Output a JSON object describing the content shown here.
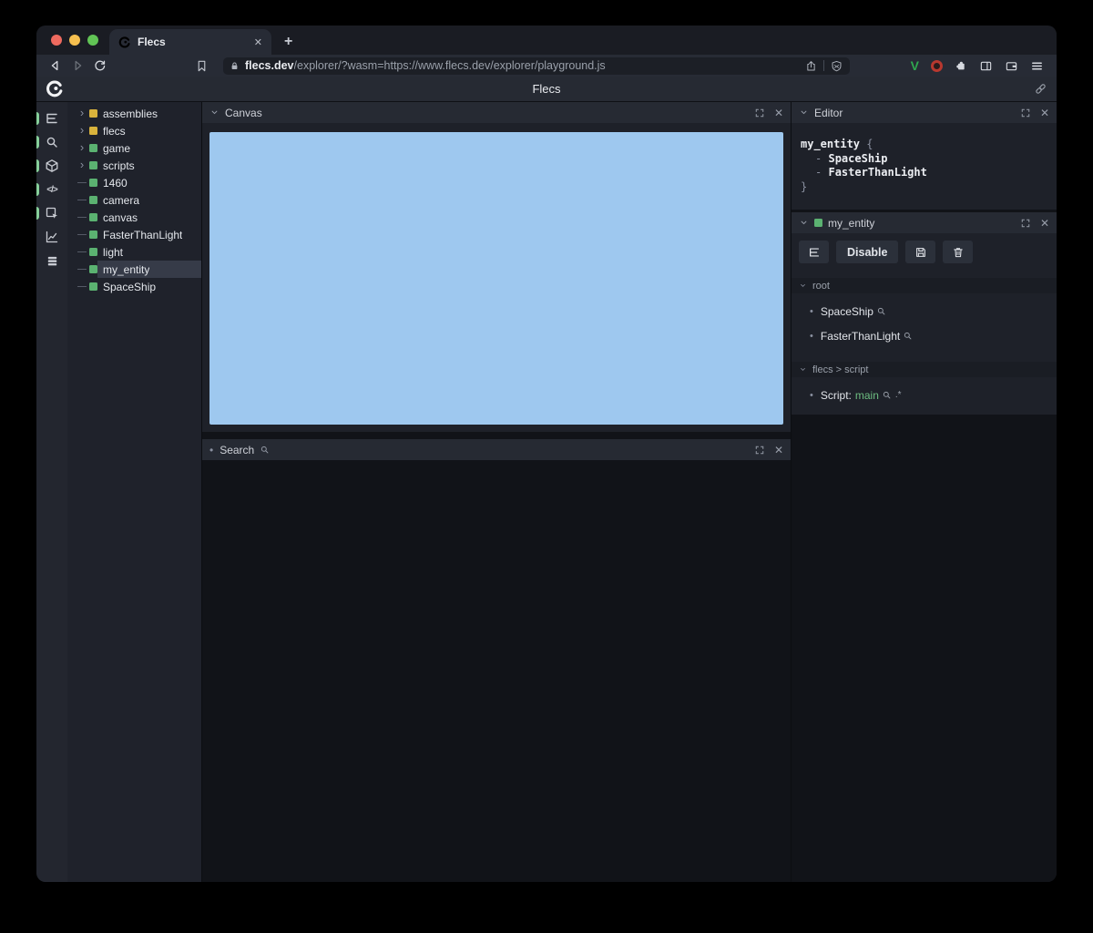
{
  "glyphs": {
    "close": "✕",
    "plus": "+",
    "bullet": "•",
    "chevron_right": "›",
    "code": "</>"
  },
  "browser": {
    "tab": {
      "title": "Flecs"
    },
    "url": {
      "domain": "flecs.dev",
      "path": "/explorer/?wasm=https://www.flecs.dev/explorer/playground.js"
    }
  },
  "app_header": {
    "title": "Flecs"
  },
  "nav_rail": {
    "items": [
      {
        "icon": "outliner-icon",
        "active": true
      },
      {
        "icon": "search-icon",
        "active": true
      },
      {
        "icon": "entities-cube-icon",
        "active": true
      },
      {
        "icon": "code-icon",
        "active": true
      },
      {
        "icon": "inspector-icon",
        "active": true
      },
      {
        "icon": "stats-chart-icon",
        "active": false
      },
      {
        "icon": "archetypes-icon",
        "active": false
      }
    ]
  },
  "tree": {
    "items": [
      {
        "label": "assemblies",
        "color": "yellow",
        "expandable": true,
        "selected": false
      },
      {
        "label": "flecs",
        "color": "yellow",
        "expandable": true,
        "selected": false
      },
      {
        "label": "game",
        "color": "green",
        "expandable": true,
        "selected": false
      },
      {
        "label": "scripts",
        "color": "green",
        "expandable": true,
        "selected": false
      },
      {
        "label": "1460",
        "color": "green",
        "expandable": false,
        "selected": false
      },
      {
        "label": "camera",
        "color": "green",
        "expandable": false,
        "selected": false
      },
      {
        "label": "canvas",
        "color": "green",
        "expandable": false,
        "selected": false
      },
      {
        "label": "FasterThanLight",
        "color": "green",
        "expandable": false,
        "selected": false
      },
      {
        "label": "light",
        "color": "green",
        "expandable": false,
        "selected": false
      },
      {
        "label": "my_entity",
        "color": "green",
        "expandable": false,
        "selected": true
      },
      {
        "label": "SpaceShip",
        "color": "green",
        "expandable": false,
        "selected": false
      }
    ]
  },
  "canvas_panel": {
    "title": "Canvas",
    "fill": "#9ec8ef"
  },
  "search_panel": {
    "title": "Search"
  },
  "editor_panel": {
    "title": "Editor",
    "code": {
      "entity": "my_entity",
      "open": "{",
      "dash": "-",
      "components": [
        "SpaceShip",
        "FasterThanLight"
      ],
      "close": "}"
    }
  },
  "entity_panel": {
    "title": "my_entity",
    "disable_label": "Disable",
    "sections": [
      {
        "title": "root",
        "items": [
          {
            "name": "SpaceShip"
          },
          {
            "name": "FasterThanLight"
          }
        ]
      },
      {
        "title": "flecs > script",
        "items": [
          {
            "label": "Script:",
            "value": "main",
            "suffix": ".*"
          }
        ]
      }
    ]
  },
  "colors": {
    "canvas_fill": "#9ec8ef",
    "entity_green": "#5bb271",
    "module_yellow": "#d9b33c",
    "accent_green": "#6dbd81",
    "traffic_red": "#ee6a5f",
    "traffic_yellow": "#f5bf4f",
    "traffic_green": "#61c455"
  }
}
